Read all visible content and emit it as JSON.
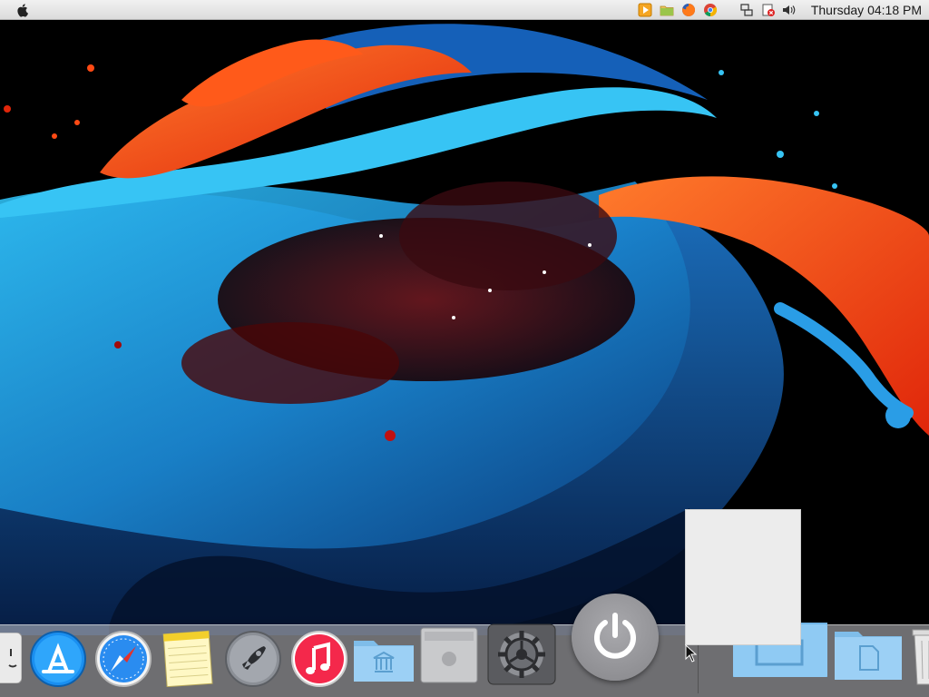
{
  "menubar": {
    "apple_icon": "apple-logo-icon",
    "tray_icons": [
      "media-player-icon",
      "folder-icon",
      "firefox-icon",
      "chrome-icon",
      "network-icon",
      "notification-blocked-icon",
      "volume-icon"
    ],
    "clock": "Thursday 04:18 PM"
  },
  "dock": {
    "items": [
      {
        "name": "finder",
        "icon": "finder-icon"
      },
      {
        "name": "app-store",
        "icon": "app-store-icon"
      },
      {
        "name": "safari",
        "icon": "safari-icon"
      },
      {
        "name": "notes",
        "icon": "notes-icon"
      },
      {
        "name": "launchpad",
        "icon": "rocket-icon"
      },
      {
        "name": "itunes",
        "icon": "music-note-icon"
      },
      {
        "name": "applications-folder",
        "icon": "folder-icon"
      },
      {
        "name": "mac-pro",
        "icon": "mac-pro-icon"
      },
      {
        "name": "system-preferences",
        "icon": "gear-icon"
      },
      {
        "name": "documents-folder",
        "icon": "folder-icon"
      },
      {
        "name": "folder",
        "icon": "folder-icon"
      },
      {
        "name": "trash",
        "icon": "trash-icon"
      }
    ]
  },
  "power_button": {
    "icon": "power-icon"
  },
  "colors": {
    "wallpaper_bg": "#000000",
    "blue_paint": "#1fa3e6",
    "orange_paint": "#ff4a14",
    "dock_bg": "#c8c8cd"
  }
}
